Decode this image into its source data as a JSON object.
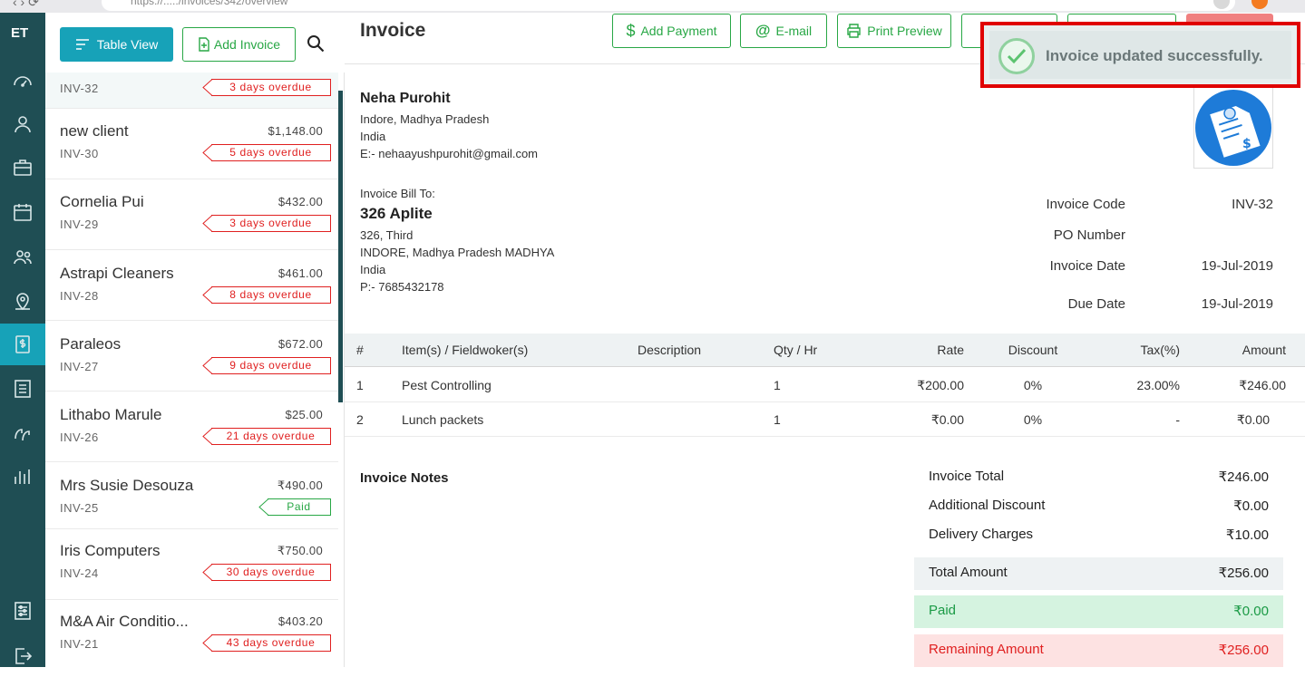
{
  "browser": {
    "url": "https://...../invoices/342/overview"
  },
  "list_header": {
    "table_view": "Table View",
    "add_invoice": "Add Invoice"
  },
  "invoices": [
    {
      "client": "",
      "code": "INV-32",
      "amount": "",
      "status": "3 days overdue",
      "kind": "overdue"
    },
    {
      "client": "new client",
      "code": "INV-30",
      "amount": "$1,148.00",
      "status": "5 days overdue",
      "kind": "overdue"
    },
    {
      "client": "Cornelia Pui",
      "code": "INV-29",
      "amount": "$432.00",
      "status": "3 days overdue",
      "kind": "overdue"
    },
    {
      "client": "Astrapi Cleaners",
      "code": "INV-28",
      "amount": "$461.00",
      "status": "8 days overdue",
      "kind": "overdue"
    },
    {
      "client": "Paraleos",
      "code": "INV-27",
      "amount": "$672.00",
      "status": "9 days overdue",
      "kind": "overdue"
    },
    {
      "client": "Lithabo Marule",
      "code": "INV-26",
      "amount": "$25.00",
      "status": "21 days overdue",
      "kind": "overdue"
    },
    {
      "client": "Mrs Susie Desouza",
      "code": "INV-25",
      "amount": "₹490.00",
      "status": "Paid",
      "kind": "paid"
    },
    {
      "client": "Iris Computers",
      "code": "INV-24",
      "amount": "₹750.00",
      "status": "30 days overdue",
      "kind": "overdue"
    },
    {
      "client": "M&A Air Conditio...",
      "code": "INV-21",
      "amount": "$403.20",
      "status": "43 days overdue",
      "kind": "overdue"
    }
  ],
  "main": {
    "title": "Invoice",
    "actions": {
      "add_payment": "Add Payment",
      "email": "E-mail",
      "print_preview": "Print Preview"
    },
    "seller": {
      "name": "Neha Purohit",
      "lines": [
        "Indore, Madhya Pradesh",
        "India",
        "E:- nehaayushpurohit@gmail.com"
      ]
    },
    "bill_to": {
      "label": "Invoice Bill To:",
      "name": "326 Aplite",
      "lines": [
        "326, Third",
        "INDORE, Madhya Pradesh MADHYA",
        "India",
        "P:- 7685432178"
      ]
    },
    "meta": {
      "invoice_code_label": "Invoice Code",
      "invoice_code": "INV-32",
      "po_label": "PO Number",
      "po": "",
      "invoice_date_label": "Invoice Date",
      "invoice_date": "19-Jul-2019",
      "due_date_label": "Due Date",
      "due_date": "19-Jul-2019"
    },
    "table": {
      "headers": [
        "#",
        "Item(s) / Fieldwoker(s)",
        "Description",
        "Qty / Hr",
        "Rate",
        "Discount",
        "Tax(%)",
        "Amount"
      ],
      "rows": [
        [
          "1",
          "Pest Controlling",
          "",
          "1",
          "₹200.00",
          "0%",
          "23.00%",
          "₹246.00"
        ],
        [
          "2",
          "Lunch packets",
          "",
          "1",
          "₹0.00",
          "0%",
          "-",
          "₹0.00"
        ]
      ]
    },
    "notes_label": "Invoice Notes",
    "totals": {
      "invoice_total_label": "Invoice Total",
      "invoice_total": "₹246.00",
      "additional_discount_label": "Additional Discount",
      "additional_discount": "₹0.00",
      "delivery_label": "Delivery Charges",
      "delivery": "₹10.00",
      "total_label": "Total Amount",
      "total": "₹256.00",
      "paid_label": "Paid",
      "paid": "₹0.00",
      "remaining_label": "Remaining Amount",
      "remaining": "₹256.00"
    }
  },
  "toast": {
    "message": "Invoice updated successfully."
  },
  "colors": {
    "rail": "#1f4e54",
    "accent": "#17a2b8",
    "success": "#28a745",
    "danger": "#e02020"
  }
}
